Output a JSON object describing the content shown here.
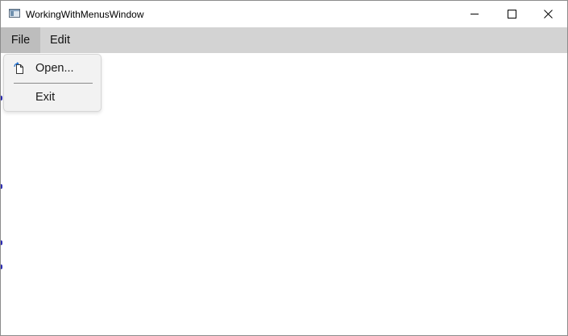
{
  "window": {
    "title": "WorkingWithMenusWindow",
    "icon": "app-window-icon",
    "controls": {
      "minimize_icon": "minimize-icon",
      "maximize_icon": "maximize-icon",
      "close_icon": "close-icon"
    }
  },
  "menubar": {
    "items": [
      {
        "label": "File",
        "state": "open"
      },
      {
        "label": "Edit",
        "state": "closed"
      }
    ],
    "background": "#d3d3d3",
    "active_background": "#bdbdbd"
  },
  "file_menu": {
    "items": [
      {
        "label": "Open...",
        "icon": "open-file-icon"
      },
      {
        "label": "Exit",
        "icon": ""
      }
    ],
    "background": "#f2f2f2"
  }
}
